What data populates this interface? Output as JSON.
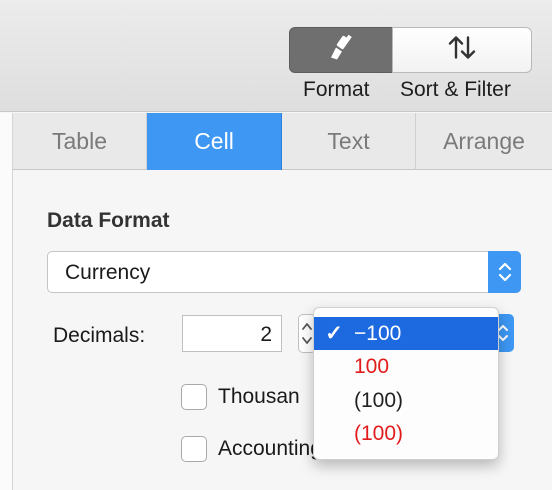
{
  "toolbar": {
    "format_label": "Format",
    "sort_filter_label": "Sort & Filter",
    "format_icon": "paintbrush-icon",
    "sort_icon": "sort-arrows-icon"
  },
  "tabs": [
    {
      "label": "Table",
      "selected": false
    },
    {
      "label": "Cell",
      "selected": true
    },
    {
      "label": "Text",
      "selected": false
    },
    {
      "label": "Arrange",
      "selected": false
    }
  ],
  "cell_panel": {
    "section_title": "Data Format",
    "data_format_value": "Currency",
    "decimals_label": "Decimals:",
    "decimals_value": "2",
    "negative_format_selected": "−100",
    "thousands_label": "Thousan",
    "accounting_label": "Accounting"
  },
  "negative_menu": {
    "items": [
      {
        "label": "−100",
        "check": "✓",
        "selected": true,
        "color": "#ffffff"
      },
      {
        "label": "100",
        "check": "",
        "selected": false,
        "color": "#e21c1c"
      },
      {
        "label": "(100)",
        "check": "",
        "selected": false,
        "color": "#111111"
      },
      {
        "label": "(100)",
        "check": "",
        "selected": false,
        "color": "#e21c1c"
      }
    ]
  },
  "colors": {
    "accent": "#3d97f3",
    "menu_highlight": "#1d69e0",
    "negative_red": "#e21c1c"
  }
}
